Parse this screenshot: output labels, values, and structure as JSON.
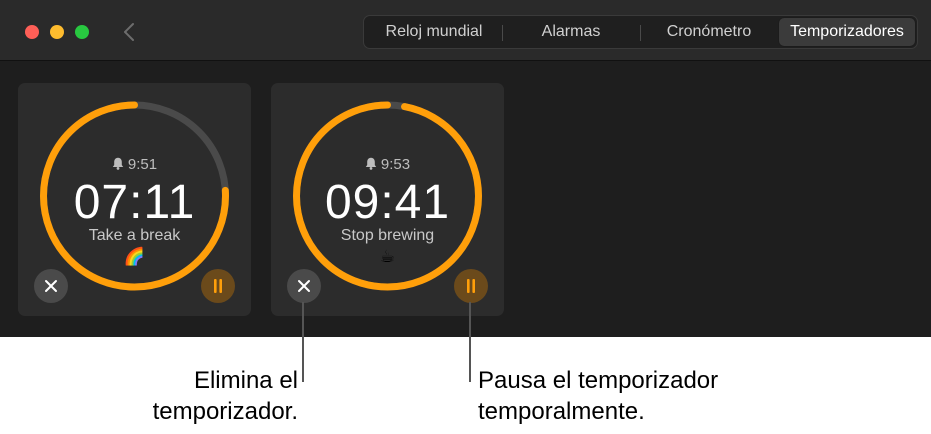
{
  "tabs": [
    {
      "label": "Reloj mundial",
      "selected": false
    },
    {
      "label": "Alarmas",
      "selected": false
    },
    {
      "label": "Cronómetro",
      "selected": false
    },
    {
      "label": "Temporizadores",
      "selected": true
    }
  ],
  "timers": [
    {
      "alarm_time": "9:51",
      "remaining": "07:11",
      "label": "Take a break",
      "emoji": "🌈",
      "progress": 0.76
    },
    {
      "alarm_time": "9:53",
      "remaining": "09:41",
      "label": "Stop brewing",
      "emoji": "☕",
      "progress": 0.97
    }
  ],
  "callouts": {
    "cancel_line1": "Elimina el",
    "cancel_line2": "temporizador.",
    "pause_line1": "Pausa el temporizador",
    "pause_line2": "temporalmente."
  },
  "colors": {
    "accent": "#ff9f0a",
    "track": "#4a4a4a"
  },
  "icons": {
    "back": "chevron-left-icon",
    "alarm": "bell-icon",
    "cancel": "close-icon",
    "pause": "pause-icon"
  }
}
